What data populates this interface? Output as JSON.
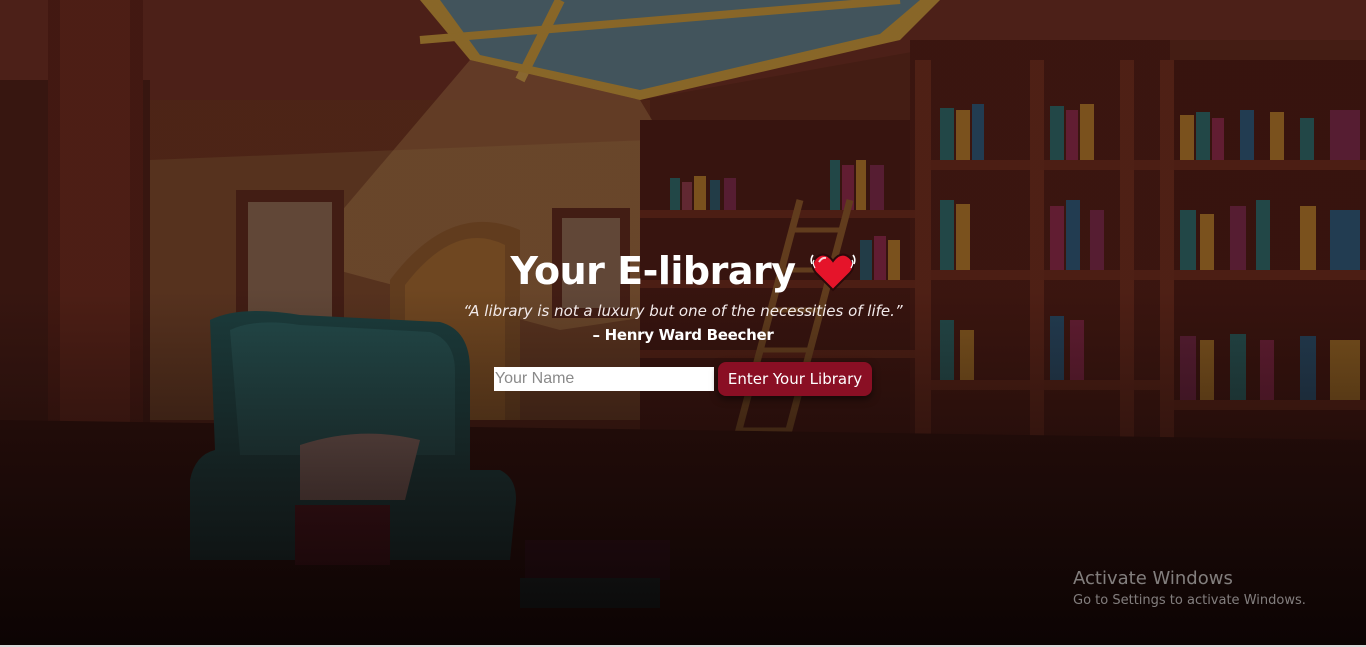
{
  "page": {
    "title": "Your E-library",
    "heart_icon": "heart-icon"
  },
  "quote": {
    "text": "“A library is not a luxury but one of the necessities of life.”",
    "author": "– Henry Ward Beecher"
  },
  "form": {
    "name_placeholder": "Your Name",
    "name_value": "",
    "enter_button_label": "Enter Your Library"
  },
  "watermark": {
    "title": "Activate Windows",
    "subtitle": "Go to Settings to activate Windows."
  },
  "colors": {
    "button_bg": "#8a0f24",
    "heart": "#e5142a",
    "background_dark": "#3a1a14"
  }
}
